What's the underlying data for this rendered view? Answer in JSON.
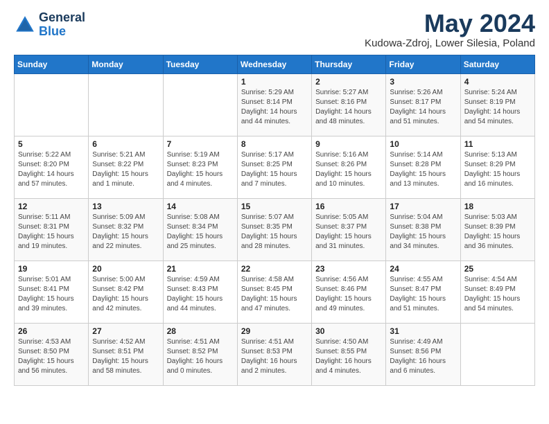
{
  "header": {
    "logo_general": "General",
    "logo_blue": "Blue",
    "month_year": "May 2024",
    "location": "Kudowa-Zdroj, Lower Silesia, Poland"
  },
  "weekdays": [
    "Sunday",
    "Monday",
    "Tuesday",
    "Wednesday",
    "Thursday",
    "Friday",
    "Saturday"
  ],
  "weeks": [
    [
      {
        "day": "",
        "sunrise": "",
        "sunset": "",
        "daylight": ""
      },
      {
        "day": "",
        "sunrise": "",
        "sunset": "",
        "daylight": ""
      },
      {
        "day": "",
        "sunrise": "",
        "sunset": "",
        "daylight": ""
      },
      {
        "day": "1",
        "sunrise": "Sunrise: 5:29 AM",
        "sunset": "Sunset: 8:14 PM",
        "daylight": "Daylight: 14 hours and 44 minutes."
      },
      {
        "day": "2",
        "sunrise": "Sunrise: 5:27 AM",
        "sunset": "Sunset: 8:16 PM",
        "daylight": "Daylight: 14 hours and 48 minutes."
      },
      {
        "day": "3",
        "sunrise": "Sunrise: 5:26 AM",
        "sunset": "Sunset: 8:17 PM",
        "daylight": "Daylight: 14 hours and 51 minutes."
      },
      {
        "day": "4",
        "sunrise": "Sunrise: 5:24 AM",
        "sunset": "Sunset: 8:19 PM",
        "daylight": "Daylight: 14 hours and 54 minutes."
      }
    ],
    [
      {
        "day": "5",
        "sunrise": "Sunrise: 5:22 AM",
        "sunset": "Sunset: 8:20 PM",
        "daylight": "Daylight: 14 hours and 57 minutes."
      },
      {
        "day": "6",
        "sunrise": "Sunrise: 5:21 AM",
        "sunset": "Sunset: 8:22 PM",
        "daylight": "Daylight: 15 hours and 1 minute."
      },
      {
        "day": "7",
        "sunrise": "Sunrise: 5:19 AM",
        "sunset": "Sunset: 8:23 PM",
        "daylight": "Daylight: 15 hours and 4 minutes."
      },
      {
        "day": "8",
        "sunrise": "Sunrise: 5:17 AM",
        "sunset": "Sunset: 8:25 PM",
        "daylight": "Daylight: 15 hours and 7 minutes."
      },
      {
        "day": "9",
        "sunrise": "Sunrise: 5:16 AM",
        "sunset": "Sunset: 8:26 PM",
        "daylight": "Daylight: 15 hours and 10 minutes."
      },
      {
        "day": "10",
        "sunrise": "Sunrise: 5:14 AM",
        "sunset": "Sunset: 8:28 PM",
        "daylight": "Daylight: 15 hours and 13 minutes."
      },
      {
        "day": "11",
        "sunrise": "Sunrise: 5:13 AM",
        "sunset": "Sunset: 8:29 PM",
        "daylight": "Daylight: 15 hours and 16 minutes."
      }
    ],
    [
      {
        "day": "12",
        "sunrise": "Sunrise: 5:11 AM",
        "sunset": "Sunset: 8:31 PM",
        "daylight": "Daylight: 15 hours and 19 minutes."
      },
      {
        "day": "13",
        "sunrise": "Sunrise: 5:09 AM",
        "sunset": "Sunset: 8:32 PM",
        "daylight": "Daylight: 15 hours and 22 minutes."
      },
      {
        "day": "14",
        "sunrise": "Sunrise: 5:08 AM",
        "sunset": "Sunset: 8:34 PM",
        "daylight": "Daylight: 15 hours and 25 minutes."
      },
      {
        "day": "15",
        "sunrise": "Sunrise: 5:07 AM",
        "sunset": "Sunset: 8:35 PM",
        "daylight": "Daylight: 15 hours and 28 minutes."
      },
      {
        "day": "16",
        "sunrise": "Sunrise: 5:05 AM",
        "sunset": "Sunset: 8:37 PM",
        "daylight": "Daylight: 15 hours and 31 minutes."
      },
      {
        "day": "17",
        "sunrise": "Sunrise: 5:04 AM",
        "sunset": "Sunset: 8:38 PM",
        "daylight": "Daylight: 15 hours and 34 minutes."
      },
      {
        "day": "18",
        "sunrise": "Sunrise: 5:03 AM",
        "sunset": "Sunset: 8:39 PM",
        "daylight": "Daylight: 15 hours and 36 minutes."
      }
    ],
    [
      {
        "day": "19",
        "sunrise": "Sunrise: 5:01 AM",
        "sunset": "Sunset: 8:41 PM",
        "daylight": "Daylight: 15 hours and 39 minutes."
      },
      {
        "day": "20",
        "sunrise": "Sunrise: 5:00 AM",
        "sunset": "Sunset: 8:42 PM",
        "daylight": "Daylight: 15 hours and 42 minutes."
      },
      {
        "day": "21",
        "sunrise": "Sunrise: 4:59 AM",
        "sunset": "Sunset: 8:43 PM",
        "daylight": "Daylight: 15 hours and 44 minutes."
      },
      {
        "day": "22",
        "sunrise": "Sunrise: 4:58 AM",
        "sunset": "Sunset: 8:45 PM",
        "daylight": "Daylight: 15 hours and 47 minutes."
      },
      {
        "day": "23",
        "sunrise": "Sunrise: 4:56 AM",
        "sunset": "Sunset: 8:46 PM",
        "daylight": "Daylight: 15 hours and 49 minutes."
      },
      {
        "day": "24",
        "sunrise": "Sunrise: 4:55 AM",
        "sunset": "Sunset: 8:47 PM",
        "daylight": "Daylight: 15 hours and 51 minutes."
      },
      {
        "day": "25",
        "sunrise": "Sunrise: 4:54 AM",
        "sunset": "Sunset: 8:49 PM",
        "daylight": "Daylight: 15 hours and 54 minutes."
      }
    ],
    [
      {
        "day": "26",
        "sunrise": "Sunrise: 4:53 AM",
        "sunset": "Sunset: 8:50 PM",
        "daylight": "Daylight: 15 hours and 56 minutes."
      },
      {
        "day": "27",
        "sunrise": "Sunrise: 4:52 AM",
        "sunset": "Sunset: 8:51 PM",
        "daylight": "Daylight: 15 hours and 58 minutes."
      },
      {
        "day": "28",
        "sunrise": "Sunrise: 4:51 AM",
        "sunset": "Sunset: 8:52 PM",
        "daylight": "Daylight: 16 hours and 0 minutes."
      },
      {
        "day": "29",
        "sunrise": "Sunrise: 4:51 AM",
        "sunset": "Sunset: 8:53 PM",
        "daylight": "Daylight: 16 hours and 2 minutes."
      },
      {
        "day": "30",
        "sunrise": "Sunrise: 4:50 AM",
        "sunset": "Sunset: 8:55 PM",
        "daylight": "Daylight: 16 hours and 4 minutes."
      },
      {
        "day": "31",
        "sunrise": "Sunrise: 4:49 AM",
        "sunset": "Sunset: 8:56 PM",
        "daylight": "Daylight: 16 hours and 6 minutes."
      },
      {
        "day": "",
        "sunrise": "",
        "sunset": "",
        "daylight": ""
      }
    ]
  ]
}
